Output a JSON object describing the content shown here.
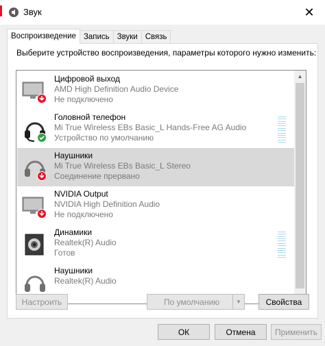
{
  "window": {
    "title": "Звук",
    "close_glyph": "✕"
  },
  "tabs": [
    {
      "label": "Воспроизведение",
      "active": true
    },
    {
      "label": "Запись"
    },
    {
      "label": "Звуки"
    },
    {
      "label": "Связь"
    }
  ],
  "hint": "Выберите устройство воспроизведения, параметры которого нужно изменить:",
  "devices": [
    {
      "name": "Цифровой выход",
      "sub": "AMD High Definition Audio Device",
      "status": "Не подключено",
      "icon": "monitor-icon",
      "badge": "disconnected"
    },
    {
      "name": "Головной телефон",
      "sub": "Mi True Wireless EBs Basic_L Hands-Free AG Audio",
      "status": "Устройство по умолчанию",
      "icon": "headset-icon",
      "badge": "default"
    },
    {
      "name": "Наушники",
      "sub": "Mi True Wireless EBs Basic_L Stereo",
      "status": "Соединение прервано",
      "icon": "headphones-icon",
      "badge": "disconnected",
      "selected": true
    },
    {
      "name": "NVIDIA Output",
      "sub": "NVIDIA High Definition Audio",
      "status": "Не подключено",
      "icon": "monitor-icon",
      "badge": "disconnected"
    },
    {
      "name": "Динамики",
      "sub": "Realtek(R) Audio",
      "status": "Готов",
      "icon": "speaker-icon",
      "badge": "none"
    },
    {
      "name": "Наушники",
      "sub": "Realtek(R) Audio",
      "status": "",
      "icon": "headphones-icon",
      "badge": "none"
    }
  ],
  "buttons": {
    "configure": "Настроить",
    "set_default": "По умолчанию",
    "properties": "Свойства",
    "ok": "ОК",
    "cancel": "Отмена",
    "apply": "Применить"
  },
  "colors": {
    "accent_red": "#e81123",
    "badge_green": "#2ea043",
    "badge_red": "#e81123",
    "selected": "#d9d9d9",
    "level": "#a8d8e8"
  }
}
